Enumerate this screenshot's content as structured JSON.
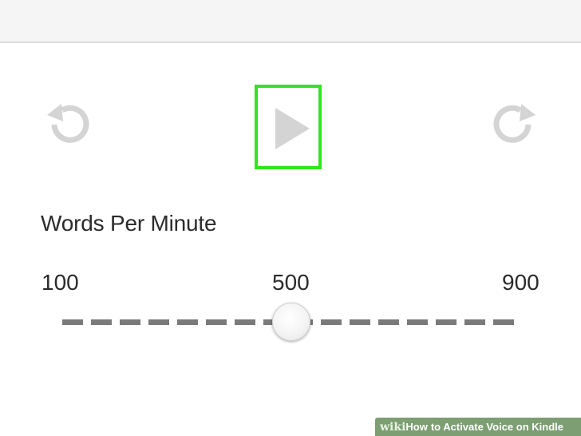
{
  "controls": {
    "rewind_icon": "rewind-icon",
    "play_icon": "play-icon",
    "forward_icon": "forward-icon",
    "highlight_color": "#2ee61f",
    "icon_color": "#d4d4d4"
  },
  "speed": {
    "label": "Words Per Minute",
    "min_label": "100",
    "mid_label": "500",
    "max_label": "900",
    "min": 100,
    "max": 900,
    "value": 500
  },
  "watermark": {
    "logo": "wiki",
    "how": "How",
    "text": "to Activate Voice on Kindle"
  }
}
